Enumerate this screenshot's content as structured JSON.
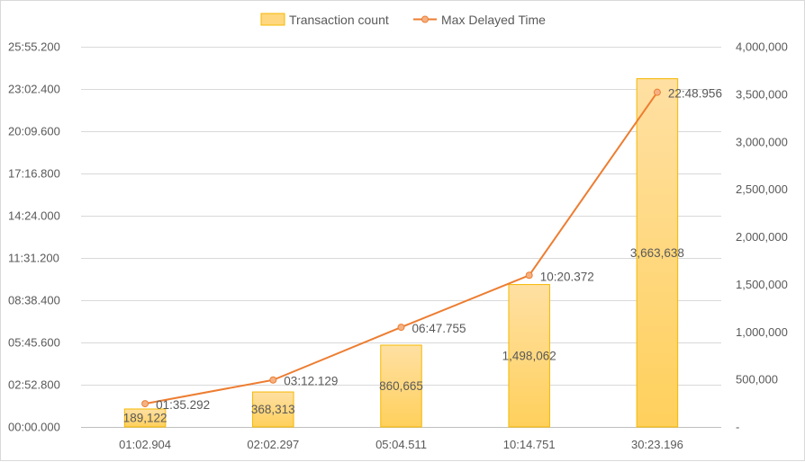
{
  "chart_data": {
    "type": "bar",
    "categories": [
      "01:02.904",
      "02:02.297",
      "05:04.511",
      "10:14.751",
      "30:23.196"
    ],
    "series": [
      {
        "name": "Transaction count",
        "type": "bar",
        "axis": "right",
        "values": [
          189122,
          368313,
          860665,
          1498062,
          3663638
        ],
        "labels": [
          "189,122",
          "368,313",
          "860,665",
          "1,498,062",
          "3,663,638"
        ],
        "color": "#FFD77F"
      },
      {
        "name": "Max Delayed Time",
        "type": "line",
        "axis": "left",
        "values": [
          95.292,
          192.129,
          407.755,
          620.372,
          1368.956
        ],
        "labels": [
          "01:35.292",
          "03:12.129",
          "06:47.755",
          "10:20.372",
          "22:48.956"
        ],
        "color": "#ED7D31"
      }
    ],
    "left_axis": {
      "ylim": [
        0,
        1555.2
      ],
      "ticks": [
        0,
        172.8,
        345.6,
        518.4,
        691.2,
        864,
        1036.8,
        1209.6,
        1382.4,
        1555.2
      ],
      "tick_labels": [
        "00:00.000",
        "02:52.800",
        "05:45.600",
        "08:38.400",
        "11:31.200",
        "14:24.000",
        "17:16.800",
        "20:09.600",
        "23:02.400",
        "25:55.200"
      ]
    },
    "right_axis": {
      "ylim": [
        0,
        4000000
      ],
      "ticks": [
        0,
        500000,
        1000000,
        1500000,
        2000000,
        2500000,
        3000000,
        3500000,
        4000000
      ],
      "tick_labels": [
        "-",
        "500,000",
        "1,000,000",
        "1,500,000",
        "2,000,000",
        "2,500,000",
        "3,000,000",
        "3,500,000",
        "4,000,000"
      ]
    },
    "grid": true,
    "legend": "top-center"
  }
}
